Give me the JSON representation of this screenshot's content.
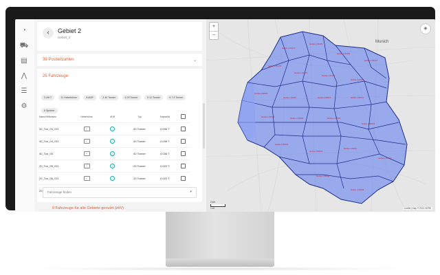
{
  "header": {
    "title": "Gebiet 2",
    "subtitle": "Gebiet_2"
  },
  "postleitzahlen": {
    "label": "39 Postleitzahlen"
  },
  "fahrzeuge": {
    "title": "25 Fahrzeuge",
    "chips": [
      "3.49t T",
      "11 Hebebühne",
      "8 ADR",
      "3 40 Tonner",
      "5 20 Tonner",
      "5 12 Tonner",
      "6 7.5 Tonner",
      "6 Sprinter"
    ],
    "columns": [
      "Name/Hilfsname",
      "Hebebühne",
      "ADR",
      "Typ",
      "Kapazität"
    ],
    "rows": [
      {
        "name": "40_Ton_03_GG",
        "hebebuehne": "minus",
        "adr": "check",
        "typ": "40 Tonner",
        "kap": "0.036 T"
      },
      {
        "name": "40_Ton_04_GG",
        "hebebuehne": "minus",
        "adr": "check",
        "typ": "40 Tonner",
        "kap": "0.036 T"
      },
      {
        "name": "40_Ton_05",
        "hebebuehne": "minus",
        "adr": "check",
        "typ": "40 Tonner",
        "kap": "0.036 T"
      },
      {
        "name": "20_Ton_05_GG",
        "hebebuehne": "minus",
        "adr": "check",
        "typ": "20 Tonner",
        "kap": "0.022 T"
      },
      {
        "name": "20_Ton_06_GG",
        "hebebuehne": "minus",
        "adr": "check",
        "typ": "20 Tonner",
        "kap": "0.022 T"
      },
      {
        "name": "20_Ton_07",
        "hebebuehne": "minus",
        "adr": "",
        "typ": "20 Tonner",
        "kap": "0.022 T"
      }
    ],
    "search_placeholder": "Fahrzeuge finden"
  },
  "footer_note": "0 Fahrzeuge für alle Gebiete genutzt (zbV)",
  "map": {
    "city": "Munich",
    "attribution": "Leaflet | Map © 2021 HERE",
    "scale_km": "2 km",
    "scale_mi": "1 mi",
    "zoom_in": "+",
    "zoom_out": "−",
    "fill_color": "#5a78f0",
    "stroke_color": "#1b2a8a",
    "region_labels": [
      "Gebiet 2 81371",
      "Gebiet 2 81379",
      "Gebiet 2 81369",
      "Gebiet 2 81477",
      "Gebiet 2 81476",
      "Gebiet 2 81475",
      "Gebiet 2 81479",
      "Gebiet 2 82049",
      "Gebiet 2 82065",
      "Gebiet 2 82067",
      "Gebiet 2 85521",
      "Gebiet 2 81547",
      "Gebiet 2 81545",
      "Gebiet 2 81549",
      "Gebiet 2 81539",
      "Gebiet 2 81541",
      "Gebiet 2 81543",
      "Gebiet 2 82024",
      "Gebiet 2 82031",
      "Gebiet 2 82041",
      "Gebiet 2 82064",
      "Gebiet 2 82008"
    ]
  }
}
